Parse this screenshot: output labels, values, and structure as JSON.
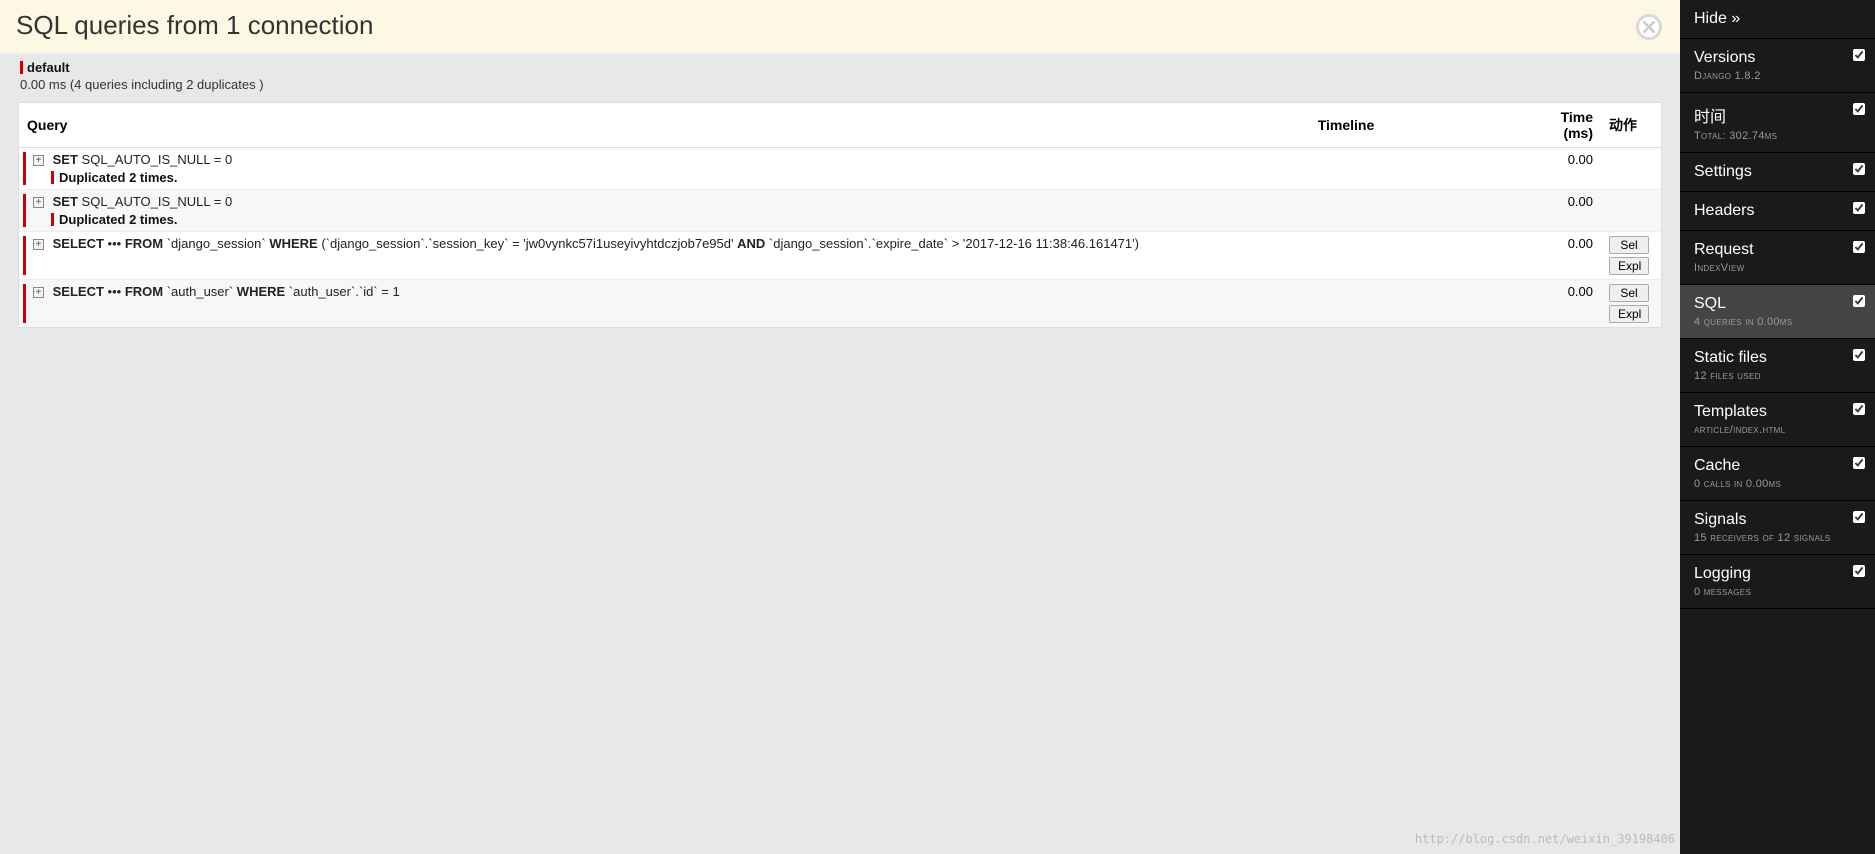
{
  "header": {
    "title": "SQL queries from 1 connection"
  },
  "connection": {
    "name": "default",
    "summary": "0.00 ms (4 queries including 2 duplicates )"
  },
  "columns": {
    "query": "Query",
    "timeline": "Timeline",
    "time": "Time (ms)",
    "action": "动作"
  },
  "rows": [
    {
      "sql_pre_kw1": "SET",
      "sql_rest1": " SQL_AUTO_IS_NULL = 0",
      "duplicated": "Duplicated 2 times.",
      "time": "0.00",
      "sel": "",
      "expl": ""
    },
    {
      "sql_pre_kw1": "SET",
      "sql_rest1": " SQL_AUTO_IS_NULL = 0",
      "duplicated": "Duplicated 2 times.",
      "time": "0.00",
      "sel": "",
      "expl": ""
    },
    {
      "sql_kw1": "SELECT",
      "sql_dots": " ••• ",
      "sql_kw2": "FROM",
      "sql_mid": " `django_session` ",
      "sql_kw3": "WHERE",
      "sql_after_where": " (`django_session`.`session_key` = 'jw0vynkc57i1useyivyhtdczjob7e95d' ",
      "sql_kw4": "AND",
      "sql_tail": " `django_session`.`expire_date` > '2017-12-16 11:38:46.161471')",
      "time": "0.00",
      "sel": "Sel",
      "expl": "Expl"
    },
    {
      "sql_kw1": "SELECT",
      "sql_dots": " ••• ",
      "sql_kw2": "FROM",
      "sql_mid": " `auth_user` ",
      "sql_kw3": "WHERE",
      "sql_after_where": " `auth_user`.`id` = 1",
      "time": "0.00",
      "sel": "Sel",
      "expl": "Expl"
    }
  ],
  "sidebar": [
    {
      "title": "Hide »",
      "sub": "",
      "check": false,
      "active": false
    },
    {
      "title": "Versions",
      "sub": "Django 1.8.2",
      "check": true,
      "active": false
    },
    {
      "title": "时间",
      "sub": "Total: 302.74ms",
      "check": true,
      "active": false
    },
    {
      "title": "Settings",
      "sub": "",
      "check": true,
      "active": false
    },
    {
      "title": "Headers",
      "sub": "",
      "check": true,
      "active": false
    },
    {
      "title": "Request",
      "sub": "IndexView",
      "check": true,
      "active": false
    },
    {
      "title": "SQL",
      "sub": "4 queries in 0.00ms",
      "check": true,
      "active": true
    },
    {
      "title": "Static files",
      "sub": "12 files used",
      "check": true,
      "active": false
    },
    {
      "title": "Templates",
      "sub": "article/index.html",
      "check": true,
      "active": false
    },
    {
      "title": "Cache",
      "sub": "0 calls in 0.00ms",
      "check": true,
      "active": false
    },
    {
      "title": "Signals",
      "sub": "15 receivers of 12 signals",
      "check": true,
      "active": false
    },
    {
      "title": "Logging",
      "sub": "0 messages",
      "check": true,
      "active": false
    }
  ],
  "watermark": "http://blog.csdn.net/weixin_39198406"
}
